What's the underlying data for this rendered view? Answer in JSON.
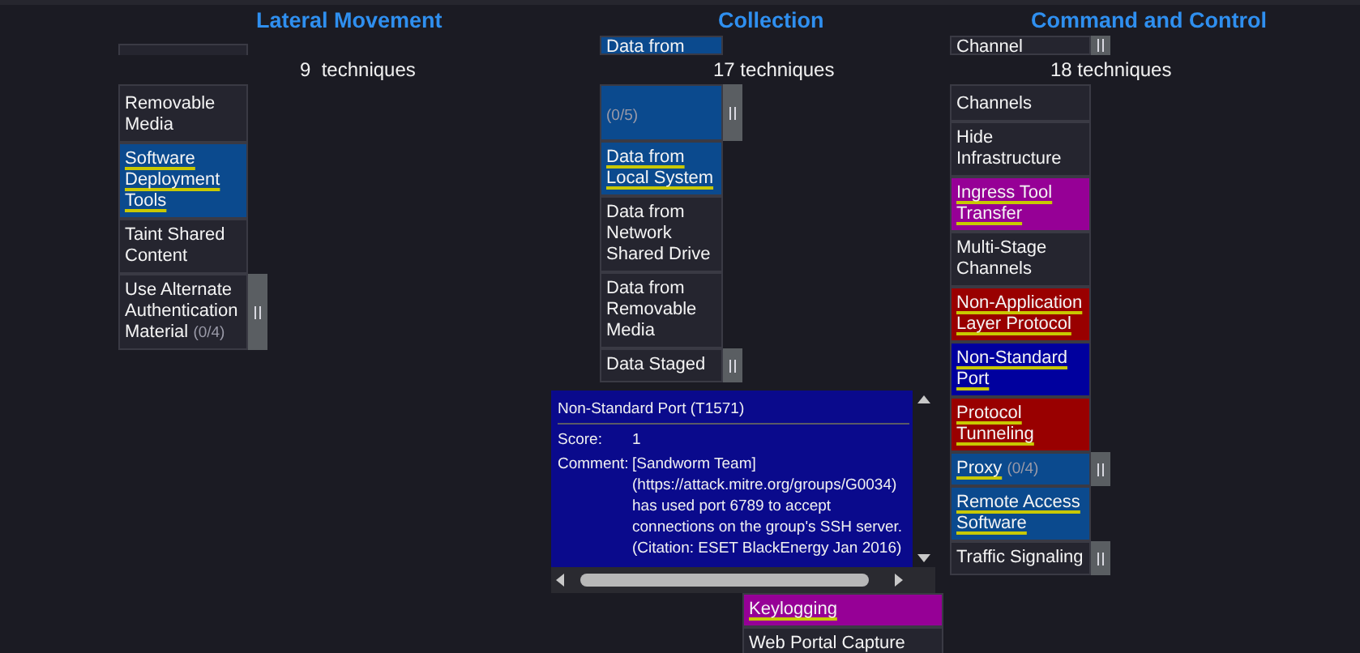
{
  "tactics": [
    {
      "name": "Lateral Movement",
      "count": "9  techniques",
      "techniques": [
        {
          "kind": "cut-top",
          "text": "Removable Media",
          "commented": false
        },
        {
          "kind": "whole",
          "text": "Software Deployment Tools",
          "color": "#0b4a8e",
          "commented": true
        },
        {
          "kind": "whole",
          "text": "Taint Shared Content",
          "commented": false
        },
        {
          "kind": "whole",
          "text": "Use Alternate Authentication Material",
          "sub_count": "(0/4)",
          "commented": false,
          "expandable": true
        }
      ]
    },
    {
      "name": "Collection",
      "count": "17 techniques",
      "techniques": [
        {
          "kind": "cut-middle",
          "text": "Data from",
          "sub_count": "(0/5)",
          "color": "#0b4a8e",
          "commented": false,
          "expandable": true
        },
        {
          "kind": "whole",
          "text": "Data from Local System",
          "color": "#0b4a8e",
          "commented": true
        },
        {
          "kind": "whole",
          "text": "Data from Network Shared Drive",
          "commented": false
        },
        {
          "kind": "whole",
          "text": "Data from Removable Media",
          "commented": false
        },
        {
          "kind": "whole",
          "text": "Data Staged",
          "commented": false,
          "expandable": true
        }
      ],
      "subtechniques": [
        {
          "kind": "whole",
          "text": "Keylogging",
          "color": "#960096",
          "commented": true
        },
        {
          "kind": "whole",
          "text": "Web Portal Capture",
          "commented": false
        }
      ]
    },
    {
      "name": "Command and Control",
      "count": "18 techniques",
      "techniques": [
        {
          "kind": "cut-bottom",
          "text": "Channel",
          "commented": false,
          "expandable": true
        },
        {
          "kind": "cut-top",
          "text": "Channels",
          "commented": false
        },
        {
          "kind": "whole",
          "text": "Hide Infrastructure",
          "commented": false
        },
        {
          "kind": "whole",
          "text": "Ingress Tool Transfer",
          "color": "#960096",
          "commented": true
        },
        {
          "kind": "whole",
          "text": "Multi-Stage Channels",
          "commented": false
        },
        {
          "kind": "whole",
          "text": "Non-Application Layer Protocol",
          "color": "#990000",
          "commented": true
        },
        {
          "kind": "whole",
          "text": "Non-Standard Port",
          "color": "#00009e",
          "commented": true
        },
        {
          "kind": "whole",
          "text": "Protocol Tunneling",
          "color": "#990000",
          "commented": true
        },
        {
          "kind": "whole",
          "text": "Proxy",
          "sub_count": "(0/4)",
          "color": "#0b4a8e",
          "commented": true,
          "expandable": true
        },
        {
          "kind": "whole",
          "text": "Remote Access Software",
          "color": "#0b4a8e",
          "commented": true
        },
        {
          "kind": "whole",
          "text": "Traffic Signaling",
          "commented": false,
          "expandable": true
        }
      ]
    }
  ],
  "tooltip": {
    "title": "Non-Standard Port (T1571)",
    "rows": [
      {
        "label": "Score:",
        "value": "1"
      },
      {
        "label": "Comment:",
        "value": "[Sandworm Team] (https://attack.mitre.org/groups/G0034) has used port 6789 to accept connections on the group's SSH server. (Citation: ESET BlackEnergy Jan 2016)"
      }
    ]
  }
}
